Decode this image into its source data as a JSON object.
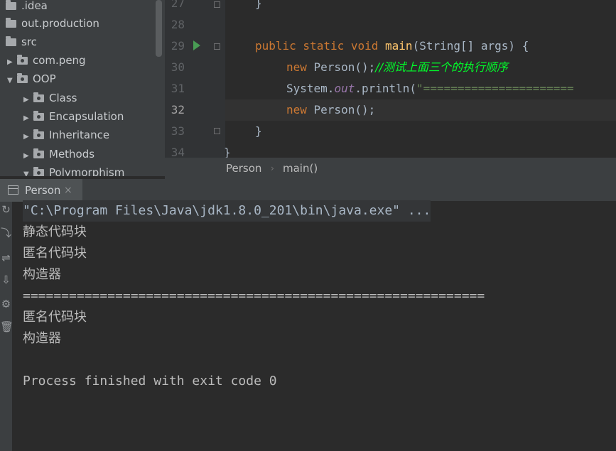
{
  "project_tree": {
    "items": [
      {
        "label": ".idea",
        "arrow": ""
      },
      {
        "label": "out.production",
        "arrow": ""
      },
      {
        "label": "src",
        "arrow": ""
      },
      {
        "label": "com.peng",
        "arrow": "▶"
      },
      {
        "label": "OOP",
        "arrow": "▼"
      },
      {
        "label": "Class",
        "arrow": "▶"
      },
      {
        "label": "Encapsulation",
        "arrow": "▶"
      },
      {
        "label": "Inheritance",
        "arrow": "▶"
      },
      {
        "label": "Methods",
        "arrow": "▶"
      },
      {
        "label": "Polymorphism",
        "arrow": "▼"
      }
    ]
  },
  "editor": {
    "line_numbers": [
      "27",
      "28",
      "29",
      "30",
      "31",
      "32",
      "33",
      "34"
    ],
    "code": {
      "l27": "}",
      "l29_mod": "public static void ",
      "l29_fn": "main",
      "l29_rest": "(String[] args) {",
      "l30_kw": "new ",
      "l30_rest": "Person();",
      "l30_comment": "//测试上面三个的执行顺序",
      "l31_a": "System.",
      "l31_out": "out",
      "l31_b": ".println(",
      "l31_str": "\"======================",
      "l32_kw": "new ",
      "l32_rest": "Person();",
      "l33": "}",
      "l34": "}"
    }
  },
  "breadcrumb": {
    "items": [
      "Person",
      "main()"
    ],
    "separator": "›"
  },
  "run_panel": {
    "tab_label": "Person",
    "close": "×",
    "tools": [
      "↻",
      "⤵",
      "⇌",
      "⇩",
      "⚙",
      "🗑"
    ]
  },
  "console": {
    "lines": [
      "\"C:\\Program Files\\Java\\jdk1.8.0_201\\bin\\java.exe\" ...",
      "静态代码块",
      "匿名代码块",
      "构造器",
      "============================================================",
      "匿名代码块",
      "构造器",
      "",
      "Process finished with exit code 0"
    ]
  },
  "colors": {
    "keyword": "#cc7832",
    "function": "#ffc66d",
    "comment": "#00ff2a",
    "static_field": "#9876aa",
    "string": "#6a8759",
    "run_icon": "#499c54"
  }
}
